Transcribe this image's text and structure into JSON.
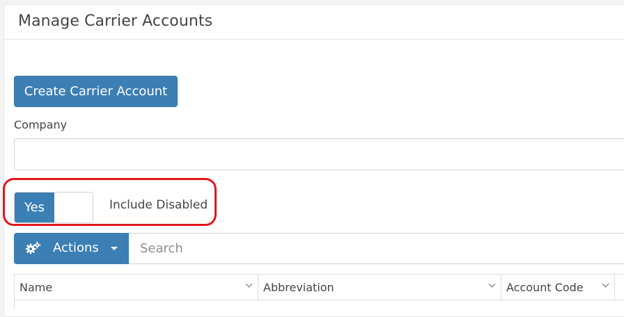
{
  "panel": {
    "title": "Manage Carrier Accounts"
  },
  "toolbar": {
    "create_label": "Create Carrier Account"
  },
  "filters": {
    "company_label": "Company",
    "company_value": "",
    "include_disabled_toggle": "Yes",
    "include_disabled_label": "Include Disabled"
  },
  "grid": {
    "actions_label": "Actions",
    "search_placeholder": "Search",
    "columns": [
      "Name",
      "Abbreviation",
      "Account Code"
    ]
  },
  "icons": {
    "actions": "gears-icon",
    "actions_caret": "caret-down-icon",
    "sort": "chevron-down-icon"
  },
  "colors": {
    "primary": "#3b7fb4",
    "highlight": "#e3141d"
  }
}
